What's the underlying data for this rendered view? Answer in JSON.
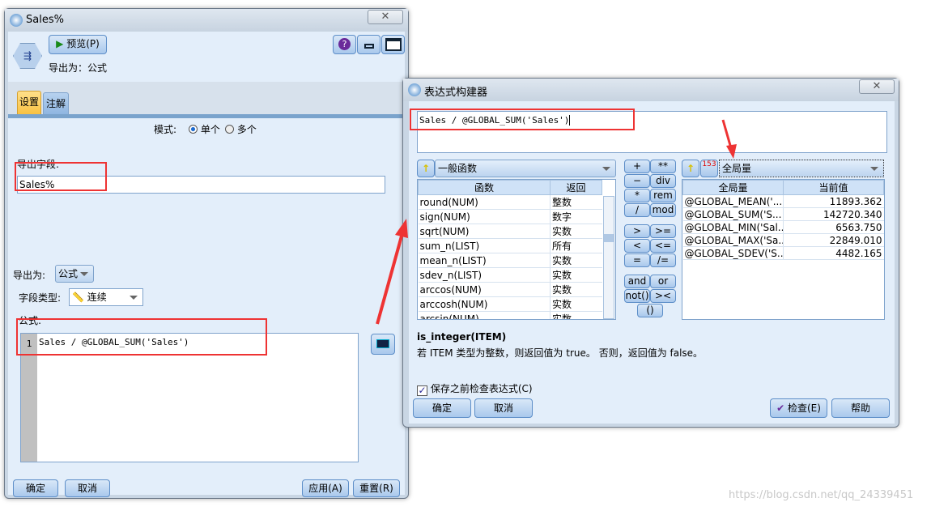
{
  "main_window": {
    "title": "Sales%",
    "close_label": "✕",
    "preview_label": "预览(P)",
    "export_as_summary": "导出为：公式",
    "tabs": [
      {
        "label": "设置",
        "active": true
      },
      {
        "label": "注解",
        "active": false
      }
    ],
    "mode_label": "模式:",
    "mode_options": [
      {
        "label": "单个",
        "selected": true
      },
      {
        "label": "多个",
        "selected": false
      }
    ],
    "derive_field_label": "导出字段:",
    "derive_field_value": "Sales%",
    "derive_as_label": "导出为:",
    "derive_as_value": "公式",
    "field_type_label": "字段类型:",
    "field_type_value": "连续",
    "formula_label": "公式:",
    "formula_line_number": "1",
    "formula_value": "Sales / @GLOBAL_SUM('Sales')",
    "buttons": {
      "ok": "确定",
      "cancel": "取消",
      "apply": "应用(A)",
      "reset": "重置(R)"
    }
  },
  "expression_builder": {
    "title": "表达式构建器",
    "close_label": "✕",
    "expression": "Sales / @GLOBAL_SUM('Sales')",
    "function_group": "一般函数",
    "function_table": {
      "headers": [
        "函数",
        "返回"
      ],
      "rows": [
        [
          "round(NUM)",
          "整数"
        ],
        [
          "sign(NUM)",
          "数字"
        ],
        [
          "sqrt(NUM)",
          "实数"
        ],
        [
          "sum_n(LIST)",
          "所有"
        ],
        [
          "mean_n(LIST)",
          "实数"
        ],
        [
          "sdev_n(LIST)",
          "实数"
        ],
        [
          "arccos(NUM)",
          "实数"
        ],
        [
          "arccosh(NUM)",
          "实数"
        ],
        [
          "arcsin(NUM)",
          "实数"
        ],
        [
          "arcsinh(NUM)",
          "实数"
        ]
      ]
    },
    "operators": [
      [
        "+",
        "**"
      ],
      [
        "−",
        "div"
      ],
      [
        "*",
        "rem"
      ],
      [
        "/",
        "mod"
      ],
      [
        ">",
        ">="
      ],
      [
        "<",
        "<="
      ],
      [
        "=",
        "/="
      ],
      [
        "and",
        "or"
      ],
      [
        "not()",
        "><"
      ],
      [
        "()"
      ]
    ],
    "field_group": "全局量",
    "field_icon_text": "153",
    "globals_table": {
      "headers": [
        "全局量",
        "当前值"
      ],
      "rows": [
        [
          "@GLOBAL_MEAN('...",
          "11893.362"
        ],
        [
          "@GLOBAL_SUM('S...",
          "142720.340"
        ],
        [
          "@GLOBAL_MIN('Sal...",
          "6563.750"
        ],
        [
          "@GLOBAL_MAX('Sa...",
          "22849.010"
        ],
        [
          "@GLOBAL_SDEV('S...",
          "4482.165"
        ]
      ]
    },
    "help_title": "is_integer(ITEM)",
    "help_text": "若 ITEM 类型为整数，则返回值为 true。 否则，返回值为 false。",
    "check_before_save_label": "保存之前检查表达式(C)",
    "check_before_save": true,
    "buttons": {
      "ok": "确定",
      "cancel": "取消",
      "check": "检查(E)",
      "help": "帮助"
    }
  },
  "watermark": "https://blog.csdn.net/qq_24339451",
  "colors": {
    "annotation_red": "#ee3333",
    "active_tab": "#fcc94a",
    "panel_bg": "#e3eefa"
  }
}
